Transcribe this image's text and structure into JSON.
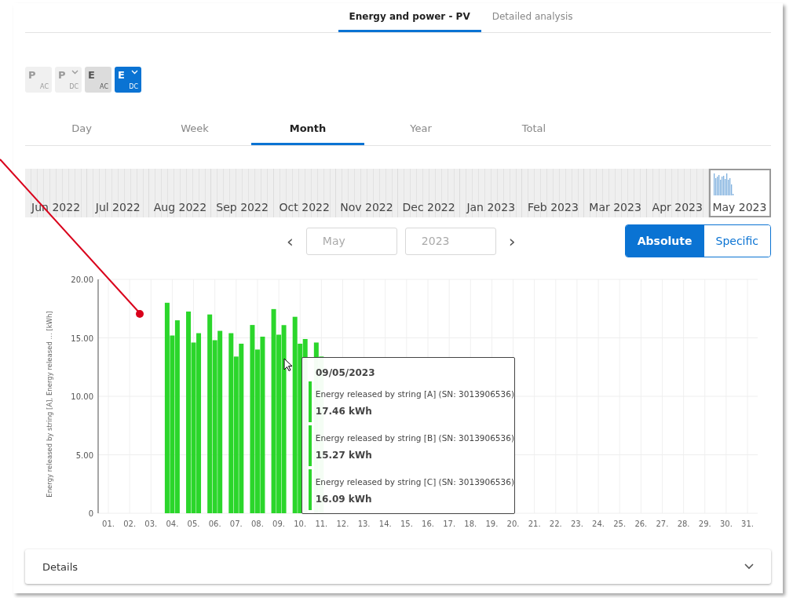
{
  "top_tabs": [
    {
      "label": "Energy and power - PV",
      "selected": true
    },
    {
      "label": "Detailed analysis",
      "selected": false
    }
  ],
  "mode_buttons": [
    {
      "letter": "P",
      "sub": "AC",
      "selected": false,
      "disabled": true,
      "dropdown": false
    },
    {
      "letter": "P",
      "sub": "DC",
      "selected": false,
      "disabled": true,
      "dropdown": true
    },
    {
      "letter": "E",
      "sub": "AC",
      "selected": false,
      "disabled": false,
      "dropdown": false
    },
    {
      "letter": "E",
      "sub": "DC",
      "selected": true,
      "disabled": false,
      "dropdown": true
    }
  ],
  "period_tabs": [
    {
      "label": "Day",
      "selected": false
    },
    {
      "label": "Week",
      "selected": false
    },
    {
      "label": "Month",
      "selected": true
    },
    {
      "label": "Year",
      "selected": false
    },
    {
      "label": "Total",
      "selected": false
    }
  ],
  "month_strip": [
    {
      "label": "Jun 2022",
      "selected": false
    },
    {
      "label": "Jul 2022",
      "selected": false
    },
    {
      "label": "Aug 2022",
      "selected": false
    },
    {
      "label": "Sep 2022",
      "selected": false
    },
    {
      "label": "Oct 2022",
      "selected": false
    },
    {
      "label": "Nov 2022",
      "selected": false
    },
    {
      "label": "Dec 2022",
      "selected": false
    },
    {
      "label": "Jan 2023",
      "selected": false
    },
    {
      "label": "Feb 2023",
      "selected": false
    },
    {
      "label": "Mar 2023",
      "selected": false
    },
    {
      "label": "Apr 2023",
      "selected": false
    },
    {
      "label": "May 2023",
      "selected": true
    }
  ],
  "nav": {
    "prev": "‹",
    "month": "May",
    "year": "2023",
    "next": "›"
  },
  "scale_toggle": [
    {
      "label": "Absolute",
      "selected": true
    },
    {
      "label": "Specific",
      "selected": false
    }
  ],
  "chart": {
    "chart_data": {
      "type": "bar",
      "ylabel": "Energy released by string [A], Energy released ... [kWh]",
      "categories": [
        "01.",
        "02.",
        "03.",
        "04.",
        "05.",
        "06.",
        "07.",
        "08.",
        "09.",
        "10.",
        "11.",
        "12.",
        "13.",
        "14.",
        "15.",
        "16.",
        "17.",
        "18.",
        "19.",
        "20.",
        "21.",
        "22.",
        "23.",
        "24.",
        "25.",
        "26.",
        "27.",
        "28.",
        "29.",
        "30.",
        "31."
      ],
      "series": [
        {
          "name": "Energy released by string [A] (SN: 3013906536)",
          "color": "#2bd62b",
          "values": [
            null,
            null,
            null,
            18.0,
            17.25,
            17.0,
            15.4,
            16.1,
            17.46,
            16.8,
            14.6,
            null,
            null,
            null,
            null,
            null,
            null,
            null,
            null,
            null,
            null,
            null,
            null,
            null,
            null,
            null,
            null,
            null,
            null,
            null,
            null
          ]
        },
        {
          "name": "Energy released by string [B] (SN: 3013906536)",
          "color": "#2bd62b",
          "values": [
            null,
            null,
            null,
            15.2,
            14.6,
            14.8,
            13.4,
            14.0,
            15.27,
            14.5,
            13.4,
            null,
            null,
            null,
            null,
            null,
            null,
            null,
            null,
            null,
            null,
            null,
            null,
            null,
            null,
            null,
            null,
            null,
            null,
            null,
            null
          ]
        },
        {
          "name": "Energy released by string [C] (SN: 3013906536)",
          "color": "#2bd62b",
          "values": [
            null,
            null,
            null,
            16.5,
            15.4,
            15.6,
            14.5,
            15.1,
            16.09,
            14.9,
            null,
            null,
            null,
            null,
            null,
            null,
            null,
            null,
            null,
            null,
            null,
            null,
            null,
            null,
            null,
            null,
            null,
            null,
            null,
            null,
            null
          ]
        }
      ],
      "ylim": [
        0,
        20
      ],
      "grid": true,
      "yticks": [
        {
          "value": 0,
          "label": "0"
        },
        {
          "value": 5,
          "label": "5.00"
        },
        {
          "value": 10,
          "label": "10.00"
        },
        {
          "value": 15,
          "label": "15.00"
        },
        {
          "value": 20,
          "label": "20.00"
        }
      ]
    },
    "tooltip": {
      "date": "09/05/2023",
      "entries": [
        {
          "value": "17.46 kWh"
        },
        {
          "value": "15.27 kWh"
        },
        {
          "value": "16.09 kWh"
        }
      ]
    }
  },
  "details": {
    "label": "Details",
    "expanded": false
  }
}
